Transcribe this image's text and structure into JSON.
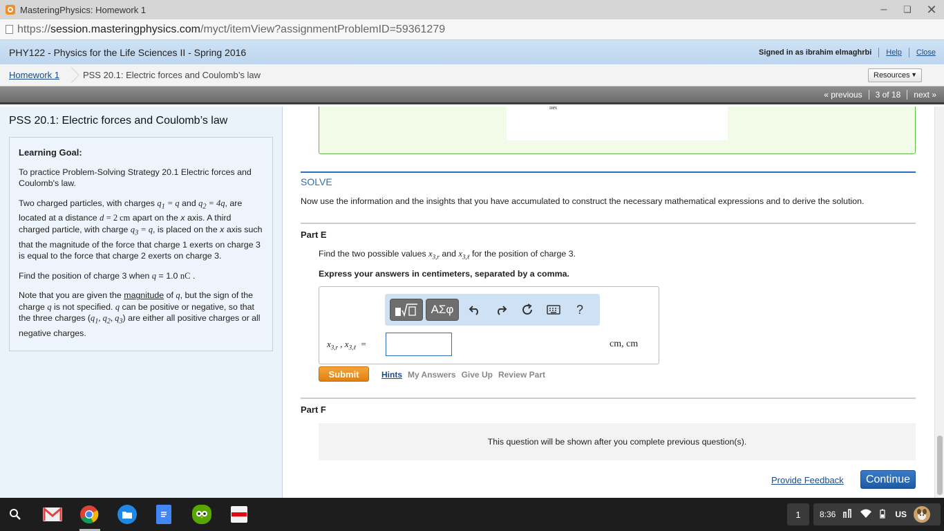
{
  "window": {
    "title": "MasteringPhysics: Homework 1",
    "url_scheme": "https://",
    "url_host": "session.masteringphysics.com",
    "url_path": "/myct/itemView?assignmentProblemID=59361279"
  },
  "header": {
    "course": "PHY122 - Physics for the Life Sciences II - Spring 2016",
    "signed_in": "Signed in as ibrahim elmaghrbi",
    "help": "Help",
    "close": "Close"
  },
  "breadcrumb": {
    "homework": "Homework 1",
    "current": "PSS 20.1: Electric forces and Coulomb’s law",
    "resources": "Resources"
  },
  "nav": {
    "previous": "« previous",
    "position": "3 of 18",
    "next": "next »"
  },
  "sidebar": {
    "title": "PSS 20.1: Electric forces and Coulomb’s law",
    "goal_heading": "Learning Goal:",
    "p1": "To practice Problem-Solving Strategy 20.1 Electric forces and Coulomb's law.",
    "p2_a": "Two charged particles, with charges",
    "p2_b": "and",
    "p2_c": ", are located at a distance",
    "p2_d": "apart on the",
    "p2_e": "axis. A third charged particle, with charge",
    "p2_f": ", is placed on the",
    "p2_g": "axis such that the magnitude of the force that charge 1 exerts on charge 3 is equal to the force that charge 2 exerts on charge 3.",
    "p3_a": "Find the position of charge 3 when",
    "p3_b": "= 1.0",
    "p4_a": "Note that you are given the",
    "p4_magnitude": "magnitude",
    "p4_b": "of",
    "p4_c": ", but the sign of the charge",
    "p4_d": "is not specified.",
    "p4_e": "can be positive or negative, so that the three charges (",
    "p4_f": ") are either all positive charges or all negative charges."
  },
  "main": {
    "net_label": "net",
    "solve_heading": "SOLVE",
    "solve_text": "Now use the information and the insights that you have accumulated to construct the necessary mathematical expressions and to derive the solution.",
    "part_e": "Part E",
    "question_a": "Find the two possible values",
    "question_b": "and",
    "question_c": "for the position of charge 3.",
    "instruction": "Express your answers in centimeters, separated by a comma.",
    "answer_value": "",
    "unit": "cm, cm",
    "submit": "Submit",
    "hints": "Hints",
    "my_answers": "My Answers",
    "give_up": "Give Up",
    "review_part": "Review Part",
    "part_f": "Part F",
    "locked_text": "This question will be shown after you complete previous question(s).",
    "feedback": "Provide Feedback",
    "continue": "Continue"
  },
  "toolbar": {
    "greek": "ΑΣφ",
    "help": "?"
  },
  "taskbar": {
    "badge": "1",
    "time": "8:36",
    "locale": "US"
  },
  "icons": [
    "mastering-logo-icon",
    "page-icon",
    "minimize-icon",
    "restore-icon",
    "close-window-icon",
    "templates-icon",
    "undo-icon",
    "redo-icon",
    "reset-icon",
    "keyboard-icon",
    "search-icon",
    "gmail-icon",
    "chrome-icon",
    "files-icon",
    "docs-icon",
    "duolingo-icon",
    "netflix-icon",
    "network-icon",
    "wifi-icon",
    "battery-icon",
    "avatar-icon"
  ],
  "colors": {
    "accent": "#2e6db4",
    "submit": "#e98f1e",
    "success_border": "#5fbb47"
  }
}
